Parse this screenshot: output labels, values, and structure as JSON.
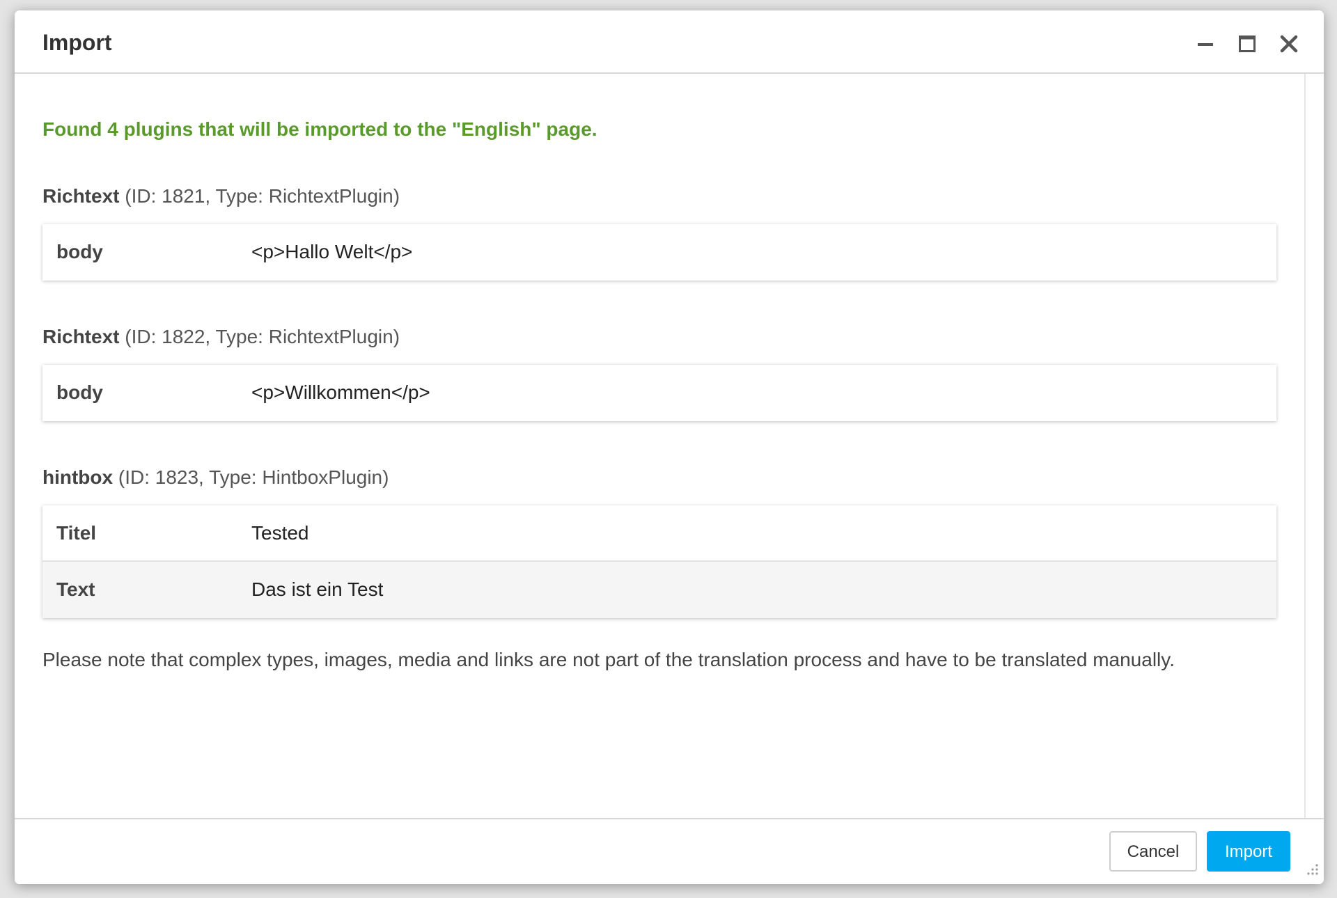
{
  "dialog": {
    "title": "Import",
    "window_controls": [
      "minimize-icon",
      "maximize-icon",
      "close-icon"
    ]
  },
  "summary": "Found 4 plugins that will be imported to the \"English\" page.",
  "plugins": [
    {
      "name": "Richtext",
      "meta": "(ID: 1821, Type: RichtextPlugin)",
      "fields": [
        {
          "key": "body",
          "value": "<p>Hallo Welt</p>"
        }
      ]
    },
    {
      "name": "Richtext",
      "meta": "(ID: 1822, Type: RichtextPlugin)",
      "fields": [
        {
          "key": "body",
          "value": "<p>Willkommen</p>"
        }
      ]
    },
    {
      "name": "hintbox",
      "meta": "(ID: 1823, Type: HintboxPlugin)",
      "fields": [
        {
          "key": "Titel",
          "value": "Tested"
        },
        {
          "key": "Text",
          "value": "Das ist ein Test"
        }
      ]
    }
  ],
  "note": "Please note that complex types, images, media and links are not part of the translation process and have to be translated manually.",
  "footer": {
    "cancel_label": "Cancel",
    "import_label": "Import"
  },
  "colors": {
    "success_text": "#5a9a2c",
    "primary_button": "#00a8f0"
  }
}
